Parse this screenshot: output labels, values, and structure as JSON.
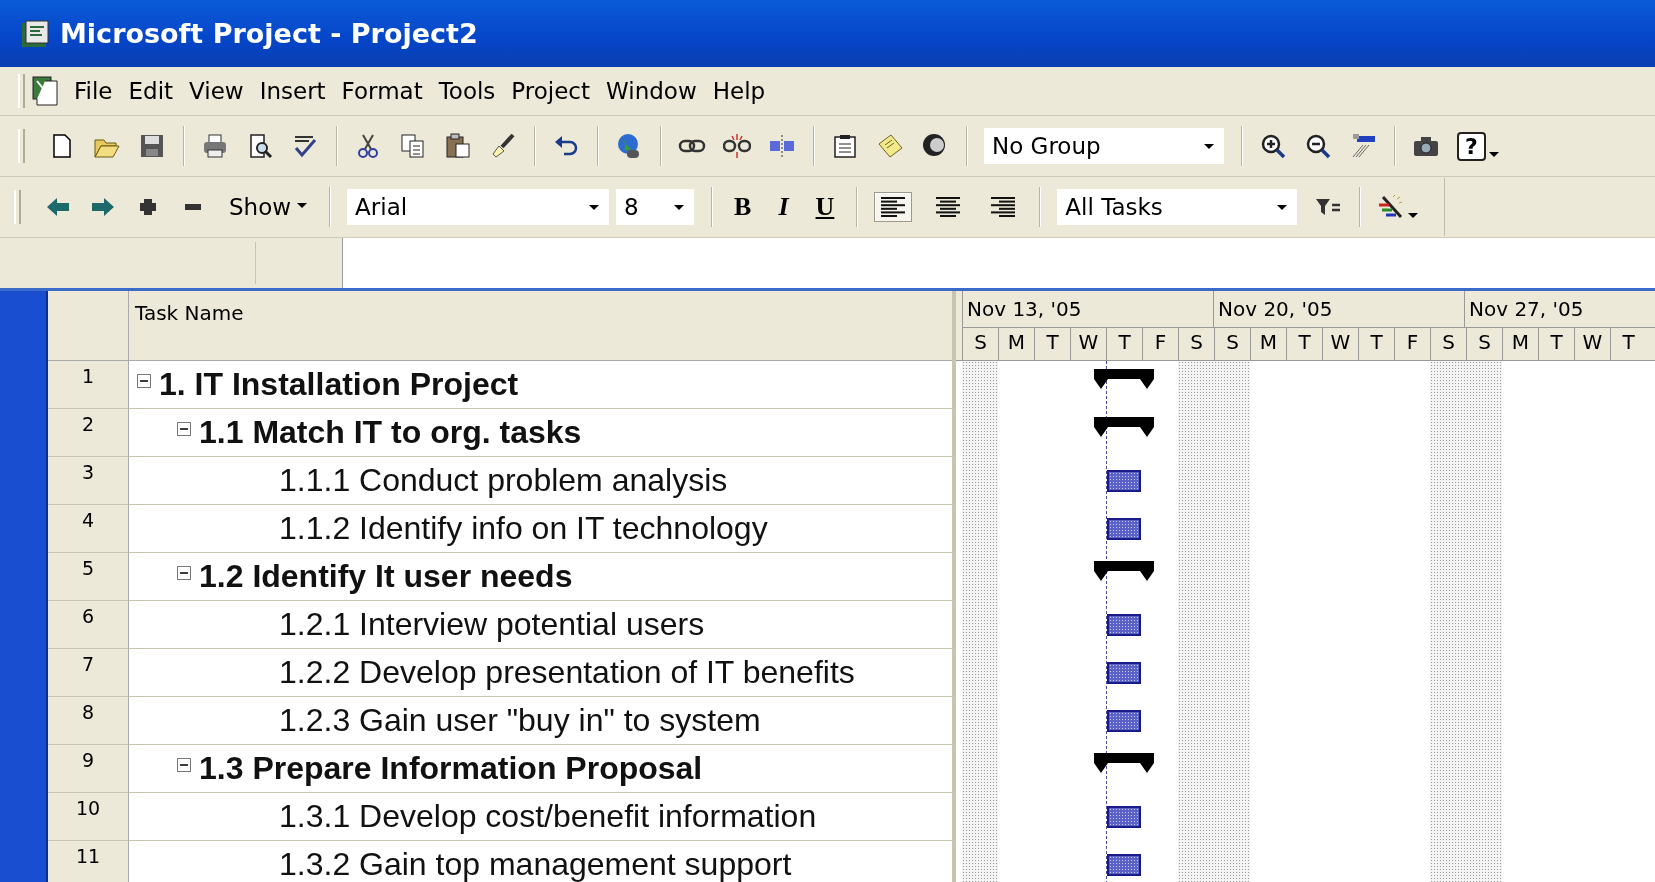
{
  "window": {
    "title": "Microsoft Project - Project2"
  },
  "menu": [
    "File",
    "Edit",
    "View",
    "Insert",
    "Format",
    "Tools",
    "Project",
    "Window",
    "Help"
  ],
  "standard_toolbar": {
    "group_dropdown": "No Group",
    "help_label": "?"
  },
  "formatting_toolbar": {
    "show_button": "Show",
    "font": "Arial",
    "font_size": "8",
    "bold": "B",
    "italic": "I",
    "underline": "U",
    "filter": "All Tasks",
    "alignments": [
      {
        "kind": "left",
        "selected": true
      },
      {
        "kind": "center",
        "selected": false
      },
      {
        "kind": "right",
        "selected": false
      }
    ]
  },
  "table": {
    "columns": [
      "Task Name"
    ],
    "tasks": [
      {
        "id": "1",
        "name": "1. IT Installation Project",
        "kind": "summary",
        "expanded": true,
        "children": [
          {
            "id": "2",
            "name": "1.1 Match IT to org. tasks",
            "kind": "summary",
            "expanded": true,
            "children": [
              {
                "id": "3",
                "name": "1.1.1 Conduct problem analysis",
                "kind": "task"
              },
              {
                "id": "4",
                "name": "1.1.2 Identify info on IT technology",
                "kind": "task"
              }
            ]
          },
          {
            "id": "5",
            "name": "1.2 Identify It user needs",
            "kind": "summary",
            "expanded": true,
            "children": [
              {
                "id": "6",
                "name": "1.2.1 Interview potential users",
                "kind": "task"
              },
              {
                "id": "7",
                "name": "1.2.2 Develop presentation of IT benefits",
                "kind": "task"
              },
              {
                "id": "8",
                "name": "1.2.3 Gain user \"buy in\" to system",
                "kind": "task"
              }
            ]
          },
          {
            "id": "9",
            "name": "1.3 Prepare Information Proposal",
            "kind": "summary",
            "expanded": true,
            "children": [
              {
                "id": "10",
                "name": "1.3.1 Develop cost/benefit information",
                "kind": "task"
              },
              {
                "id": "11",
                "name": "1.3.2 Gain top management support",
                "kind": "task"
              }
            ]
          }
        ]
      }
    ]
  },
  "gantt": {
    "weeks": [
      "Nov 13, '05",
      "Nov 20, '05",
      "Nov 27, '05"
    ],
    "days": [
      "S",
      "M",
      "T",
      "W",
      "T",
      "F",
      "S",
      "S",
      "M",
      "T",
      "W",
      "T",
      "F",
      "S",
      "S",
      "M",
      "T",
      "W",
      "T"
    ]
  }
}
